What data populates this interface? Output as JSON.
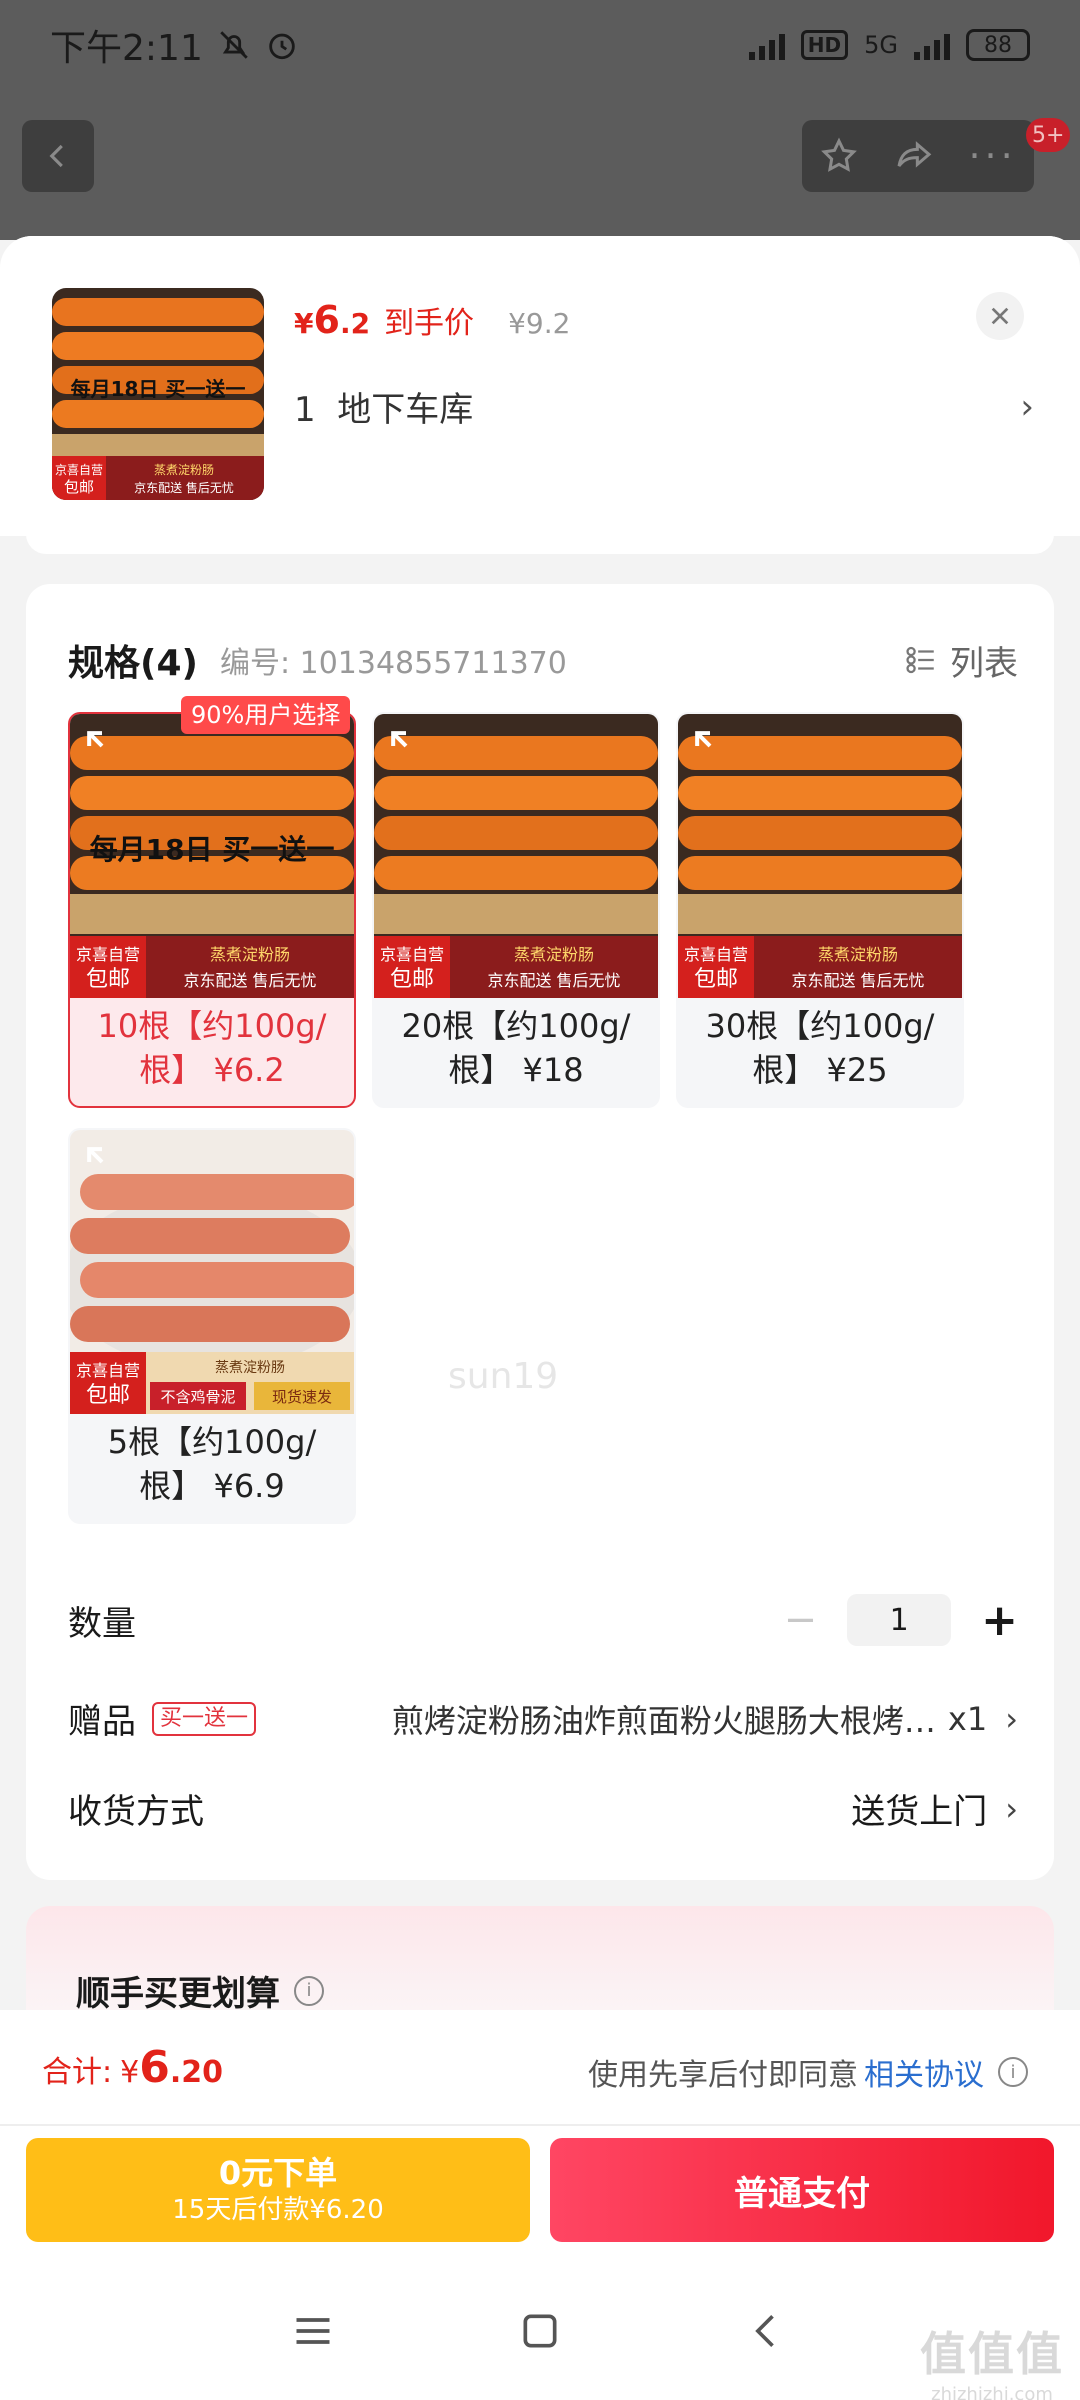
{
  "status_bar": {
    "time": "下午2:11",
    "network": "5G",
    "hd": "HD",
    "battery": "88"
  },
  "top_nav": {
    "badge": "5+"
  },
  "product": {
    "price_symbol": "¥",
    "price_int": "6",
    "price_dec": ".2",
    "price_tag": "到手价",
    "original_price": "¥9.2",
    "address": "1  地下车库"
  },
  "spec": {
    "title": "规格(4)",
    "code": "编号: 10134855711370",
    "list_label": "列表",
    "badge": "90%用户选择",
    "options": [
      {
        "label": "10根【约100g/根】 ¥6.2",
        "selected": true
      },
      {
        "label": "20根【约100g/根】 ¥18",
        "selected": false
      },
      {
        "label": "30根【约100g/根】 ¥25",
        "selected": false
      },
      {
        "label": "5根【约100g/根】 ¥6.9",
        "selected": false
      }
    ],
    "promo_text_1": "每月18日 买一送一",
    "store_tag_1": "京喜自营",
    "store_tag_2": "包邮",
    "banner_1": "蒸煮淀粉肠",
    "banner_2": "京东配送 售后无忧",
    "banner_3": "不含鸡骨泥",
    "banner_4": "现货速发"
  },
  "quantity": {
    "label": "数量",
    "value": "1",
    "minus": "−",
    "plus": "+"
  },
  "gift": {
    "label": "赠品",
    "tag": "买一送一",
    "text": "煎烤淀粉肠油炸煎面粉火腿肠大根烤…",
    "qty": "x1"
  },
  "delivery": {
    "label": "收货方式",
    "value": "送货上门"
  },
  "upsell": {
    "title": "顺手买更划算"
  },
  "watermark": "sun19",
  "pay": {
    "total_label": "合计:",
    "total_symbol": "¥",
    "total_int": "6",
    "total_dec": ".20",
    "agree_text": "使用先享后付即同意",
    "agree_link": "相关协议",
    "later_title": "0元下单",
    "later_sub": "15天后付款¥6.20",
    "pay_button": "普通支付"
  },
  "site_watermark": {
    "logo": "值值值",
    "domain": "zhizhizhi.com"
  },
  "colors": {
    "accent": "#e2231a",
    "later": "#ffbe17",
    "pay": "#f1172b",
    "link": "#2a6ecf"
  }
}
